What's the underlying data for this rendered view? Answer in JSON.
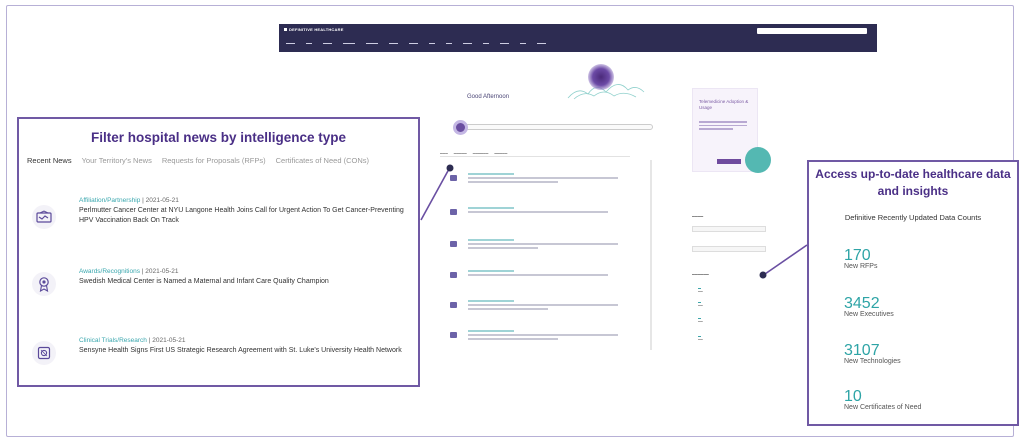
{
  "left_callout": {
    "title": "Filter hospital news by intelligence type",
    "tabs": [
      {
        "label": "Recent News",
        "active": true
      },
      {
        "label": "Your Territory's News",
        "active": false
      },
      {
        "label": "Requests for Proposals (RFPs)",
        "active": false
      },
      {
        "label": "Certificates of Need (CONs)",
        "active": false
      }
    ],
    "news": [
      {
        "icon": "handshake-icon",
        "category": "Affiliation/Partnership",
        "date": "| 2021-05-21",
        "headline": "Perlmutter Cancer Center at NYU Langone Health Joins Call for Urgent Action To Get Cancer-Preventing HPV Vaccination Back On Track"
      },
      {
        "icon": "award-ribbon-icon",
        "category": "Awards/Recognitions",
        "date": "| 2021-05-21",
        "headline": "Swedish Medical Center is Named a Maternal and Infant Care Quality Champion"
      },
      {
        "icon": "clinical-trial-icon",
        "category": "Clinical Trials/Research",
        "date": "| 2021-05-21",
        "headline": "Sensyne Health Signs First US Strategic Research Agreement with St. Luke's University Health Network"
      }
    ]
  },
  "right_callout": {
    "title": "Access up-to-date healthcare data and insights",
    "subtitle": "Definitive Recently Updated Data Counts",
    "stats": [
      {
        "value": "170",
        "label": "New RFPs"
      },
      {
        "value": "3452",
        "label": "New Executives"
      },
      {
        "value": "3107",
        "label": "New Technologies"
      },
      {
        "value": "10",
        "label": "New Certificates of Need"
      }
    ]
  },
  "screenshot": {
    "brand": "DEFINITIVE HEALTHCARE",
    "greeting": "Good Afternoon",
    "ad_title": "Telemedicine Adoption & Usage",
    "colors": {
      "brand_dark": "#2d2c52",
      "accent_purple": "#4a2f86",
      "accent_teal": "#2ea4a6"
    }
  }
}
